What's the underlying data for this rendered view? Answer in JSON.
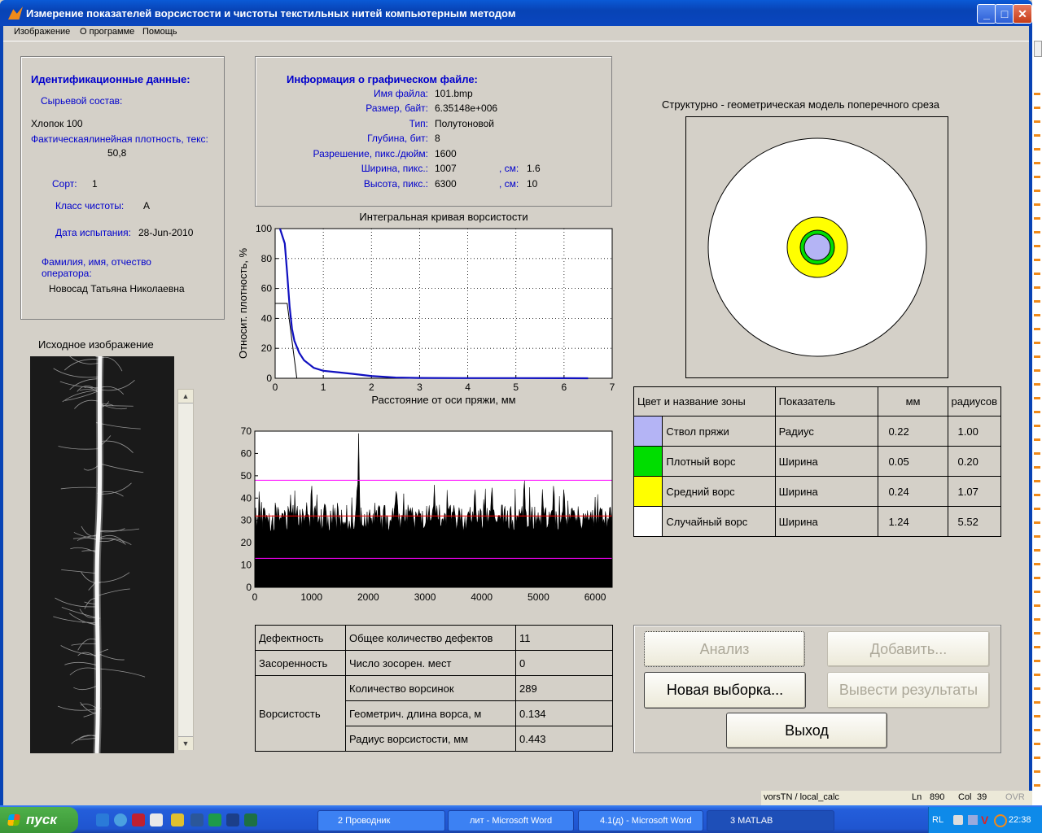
{
  "window": {
    "title": "Измерение показателей ворсистости и чистоты текстильных нитей компьютерным методом"
  },
  "menu": [
    "Изображение",
    "О программе",
    "Помощь"
  ],
  "id_panel": {
    "heading": "Идентификационные данные:",
    "composition_label": "Сырьевой состав:",
    "composition_value": "Хлопок 100",
    "density_label": "Фактическаялинейная плотность, текс:",
    "density_value": "50,8",
    "grade_label": "Сорт:",
    "grade_value": "1",
    "clean_label": "Класс чистоты:",
    "clean_value": "A",
    "date_label": "Дата испытания:",
    "date_value": "28-Jun-2010",
    "operator_label1": "Фамилия, имя, отчество",
    "operator_label2": "оператора:",
    "operator_value": "Новосад Татьяна Николаевна"
  },
  "file_panel": {
    "heading": "Информация о графическом файле:",
    "rows": [
      {
        "label": "Имя файла:",
        "value": "101.bmp"
      },
      {
        "label": "Размер, байт:",
        "value": "6.35148e+006"
      },
      {
        "label": "Тип:",
        "value": "Полутоновой"
      },
      {
        "label": "Глубина, бит:",
        "value": "8"
      },
      {
        "label": "Разрешение, пикс./дюйм:",
        "value": "1600"
      },
      {
        "label": "Ширина, пикс.:",
        "value": "1007",
        "extra_label": ", см:",
        "extra_value": "1.6"
      },
      {
        "label": "Высота, пикс.:",
        "value": "6300",
        "extra_label": ", см:",
        "extra_value": "10"
      }
    ]
  },
  "source_image_title": "Исходное изображение",
  "model_title": "Структурно - геометрическая модель поперечного среза",
  "zone_table": {
    "headers": [
      "Цвет и название зоны",
      "Показатель",
      "мм",
      "радиусов"
    ],
    "rows": [
      {
        "color": "#b4b4f5",
        "name": "Ствол пряжи",
        "param": "Радиус",
        "mm": "0.22",
        "rad": "1.00"
      },
      {
        "color": "#00dd00",
        "name": "Плотный ворс",
        "param": "Ширина",
        "mm": "0.05",
        "rad": "0.20"
      },
      {
        "color": "#ffff00",
        "name": "Средний ворс",
        "param": "Ширина",
        "mm": "0.24",
        "rad": "1.07"
      },
      {
        "color": "#ffffff",
        "name": "Случайный ворс",
        "param": "Ширина",
        "mm": "1.24",
        "rad": "5.52"
      }
    ]
  },
  "results_table": {
    "defect_group": "Дефектность",
    "defect_label": "Общее количество дефектов",
    "defect_value": "11",
    "trash_group": "Засоренность",
    "trash_label": "Число зосорен. мест",
    "trash_value": "0",
    "hair_group": "Ворсистость",
    "hair_rows": [
      {
        "label": "Количество ворсинок",
        "value": "289"
      },
      {
        "label": "Геометрич. длина ворса, м",
        "value": "0.134"
      },
      {
        "label": "Радиус ворсистости, мм",
        "value": "0.443"
      }
    ]
  },
  "buttons": {
    "analyze": "Анализ",
    "add": "Добавить...",
    "new_sample": "Новая выборка...",
    "export": "Вывести результаты",
    "exit": "Выход"
  },
  "chart_data": [
    {
      "type": "line",
      "title": "Интегральная кривая ворсистости",
      "xlabel": "Расстояние от оси пряжи, мм",
      "ylabel": "Относит. плотность, %",
      "xlim": [
        0,
        7
      ],
      "ylim": [
        0,
        100
      ],
      "xticks": [
        "0",
        "1",
        "2",
        "3",
        "4",
        "5",
        "6",
        "7"
      ],
      "yticks": [
        "0",
        "20",
        "40",
        "60",
        "80",
        "100"
      ],
      "grid": "dotted",
      "series": [
        {
          "x": [
            0.1,
            0.2,
            0.25,
            0.3,
            0.35,
            0.4,
            0.5,
            0.6,
            0.8,
            1.0,
            1.3,
            1.6,
            2.0,
            2.5,
            3.0,
            4.0,
            5.0,
            6.0,
            6.5
          ],
          "y": [
            100,
            90,
            70,
            48,
            33,
            25,
            17,
            12,
            7,
            5,
            4,
            3,
            1.5,
            0.5,
            0.2,
            0.1,
            0.1,
            0.05,
            0
          ]
        }
      ],
      "reference_line": {
        "x": [
          0,
          0.25,
          0.45
        ],
        "y": [
          50,
          50,
          0
        ]
      }
    },
    {
      "type": "area",
      "xlim": [
        0,
        6300
      ],
      "ylim": [
        0,
        70
      ],
      "xticks": [
        "0",
        "1000",
        "2000",
        "3000",
        "4000",
        "5000",
        "6000"
      ],
      "yticks": [
        "0",
        "10",
        "20",
        "30",
        "40",
        "50",
        "60",
        "70"
      ],
      "baseline_mean": 31,
      "hlines": [
        {
          "y": 48,
          "color": "#ff00ff"
        },
        {
          "y": 32,
          "color": "#ff0000"
        },
        {
          "y": 13,
          "color": "#ff00ff"
        }
      ],
      "peaks": [
        {
          "x": 1830,
          "y": 69
        },
        {
          "x": 1000,
          "y": 49
        },
        {
          "x": 4750,
          "y": 52
        },
        {
          "x": 4180,
          "y": 48
        },
        {
          "x": 5270,
          "y": 49
        },
        {
          "x": 3880,
          "y": 47
        },
        {
          "x": 5450,
          "y": 47
        },
        {
          "x": 2500,
          "y": 44
        }
      ]
    }
  ],
  "status": {
    "path": "vorsTN / local_calc",
    "ln_label": "Ln",
    "ln_value": "890",
    "col_label": "Col",
    "col_value": "39",
    "ovr": "OVR"
  },
  "taskbar": {
    "start": "пуск",
    "tasks": [
      "2 Проводник",
      "лит - Microsoft Word",
      "4.1(д) - Microsoft Word",
      "3 MATLAB"
    ],
    "lang": "RL",
    "time": "22:38"
  }
}
